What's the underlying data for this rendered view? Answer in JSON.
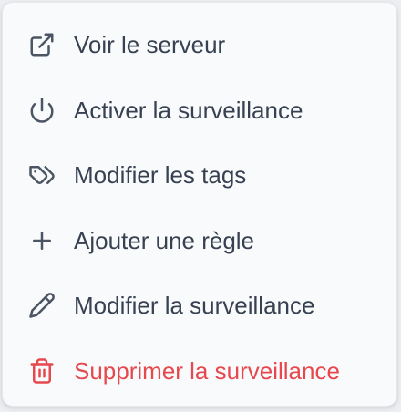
{
  "colors": {
    "text": "#374151",
    "icon": "#4b5563",
    "danger": "#e5484d"
  },
  "menu": {
    "items": [
      {
        "label": "Voir le serveur",
        "icon": "external-link-icon",
        "danger": false
      },
      {
        "label": "Activer la surveillance",
        "icon": "power-icon",
        "danger": false
      },
      {
        "label": "Modifier les tags",
        "icon": "tag-icon",
        "danger": false
      },
      {
        "label": "Ajouter une règle",
        "icon": "plus-icon",
        "danger": false
      },
      {
        "label": "Modifier la surveillance",
        "icon": "pencil-icon",
        "danger": false
      },
      {
        "label": "Supprimer la surveillance",
        "icon": "trash-icon",
        "danger": true
      }
    ]
  }
}
